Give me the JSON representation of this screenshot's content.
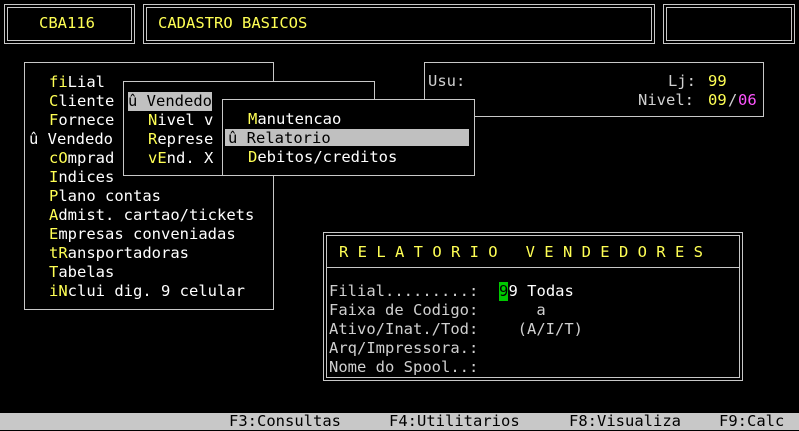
{
  "header": {
    "code": "CBA116",
    "title": "CADASTRO BASICOS"
  },
  "info_panel": {
    "user_label": "Usu:",
    "store_label": "Lj:",
    "store_value": "99",
    "level_label": "Nivel:",
    "level_current": "09",
    "level_sep": "/",
    "level_max": "06"
  },
  "main_menu": {
    "items": [
      {
        "hot": "",
        "hot_key": "fi",
        "rest": "Lial",
        "prefix": ""
      },
      {
        "prefix": "",
        "hot_key": "C",
        "rest": "liente"
      },
      {
        "prefix": "",
        "hot_key": "F",
        "rest": "ornece"
      },
      {
        "prefix": "û ",
        "hot_key": "",
        "rest": "Vendedo"
      },
      {
        "prefix": "",
        "hot_key": "cO",
        "rest": "mprad"
      },
      {
        "prefix": "",
        "hot_key": "I",
        "rest": "ndices"
      },
      {
        "prefix": "",
        "hot_key": "P",
        "rest": "lano contas"
      },
      {
        "prefix": "",
        "hot_key": "A",
        "rest": "dmist. cartao/tickets"
      },
      {
        "prefix": "",
        "hot_key": "E",
        "rest": "mpresas conveniadas"
      },
      {
        "prefix": "",
        "hot_key": "tR",
        "rest": "ansportadoras"
      },
      {
        "prefix": "",
        "hot_key": "T",
        "rest": "abelas"
      },
      {
        "prefix": "",
        "hot_key": "iN",
        "rest": "clui dig. 9 celular"
      }
    ]
  },
  "sub_menu": {
    "title": "û Vendedo",
    "items": [
      {
        "hot_key": "N",
        "rest": "ivel v"
      },
      {
        "hot_key": "R",
        "rest": "eprese"
      },
      {
        "hot_key": "vE",
        "rest": "nd. X"
      }
    ]
  },
  "sub_sub_menu": {
    "items": [
      {
        "prefix": "",
        "hot_key": "M",
        "rest": "anutencao"
      },
      {
        "prefix": "û ",
        "hot_key": "R",
        "rest": "elatorio"
      },
      {
        "prefix": "",
        "hot_key": "D",
        "rest": "ebitos/creditos"
      }
    ]
  },
  "report": {
    "title": "R E L A T O R I O   V E N D E D O R E S",
    "fields": [
      {
        "label": "Filial.........:",
        "cursor": "9",
        "value": "9 Todas"
      },
      {
        "label": "Faixa de Codigo:",
        "value": "    a"
      },
      {
        "label": "Ativo/Inat./Tod:",
        "value": "  (A/I/T)"
      },
      {
        "label": "Arq/Impressora.:",
        "value": ""
      },
      {
        "label": "Nome do Spool..:",
        "value": ""
      }
    ]
  },
  "status_bar": {
    "f3": "F3:Consultas",
    "f4": "F4:Utilitarios",
    "f8": "F8:Visualiza",
    "f9": "F9:Calc"
  }
}
